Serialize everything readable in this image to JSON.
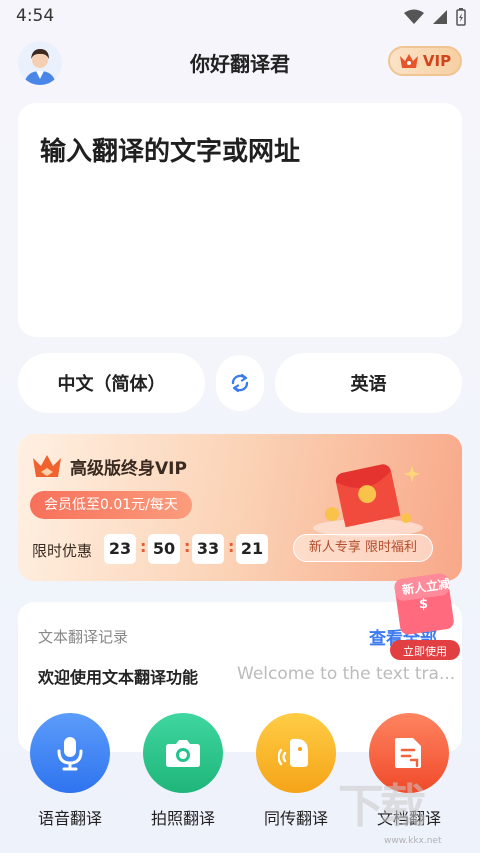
{
  "status_bar": {
    "time": "4:54"
  },
  "header": {
    "title": "你好翻译君",
    "vip_label": "VIP"
  },
  "input": {
    "placeholder": "输入翻译的文字或网址"
  },
  "languages": {
    "source": "中文（简体）",
    "target": "英语"
  },
  "promo": {
    "title": "高级版终身VIP",
    "subtitle": "会员低至0.01元/每天",
    "limit_label": "限时优惠",
    "countdown": [
      "23",
      "50",
      "33",
      "21"
    ],
    "tag": "新人专享 限时福利"
  },
  "history": {
    "label": "文本翻译记录",
    "view_all": "查看全部",
    "welcome_cn": "欢迎使用文本翻译功能",
    "welcome_en": "Welcome to the text tra..."
  },
  "float_badge": {
    "line1": "新人立减",
    "symbol": "$",
    "button": "立即使用"
  },
  "actions": [
    {
      "label": "语音翻译",
      "icon": "microphone-icon",
      "color": "#3d86f5"
    },
    {
      "label": "拍照翻译",
      "icon": "camera-icon",
      "color": "#25c38b"
    },
    {
      "label": "同传翻译",
      "icon": "simultaneous-icon",
      "color": "#f7b22b"
    },
    {
      "label": "文档翻译",
      "icon": "document-icon",
      "color": "#f4623c"
    }
  ],
  "watermark": {
    "text": "下载",
    "site": "www.kkx.net"
  }
}
